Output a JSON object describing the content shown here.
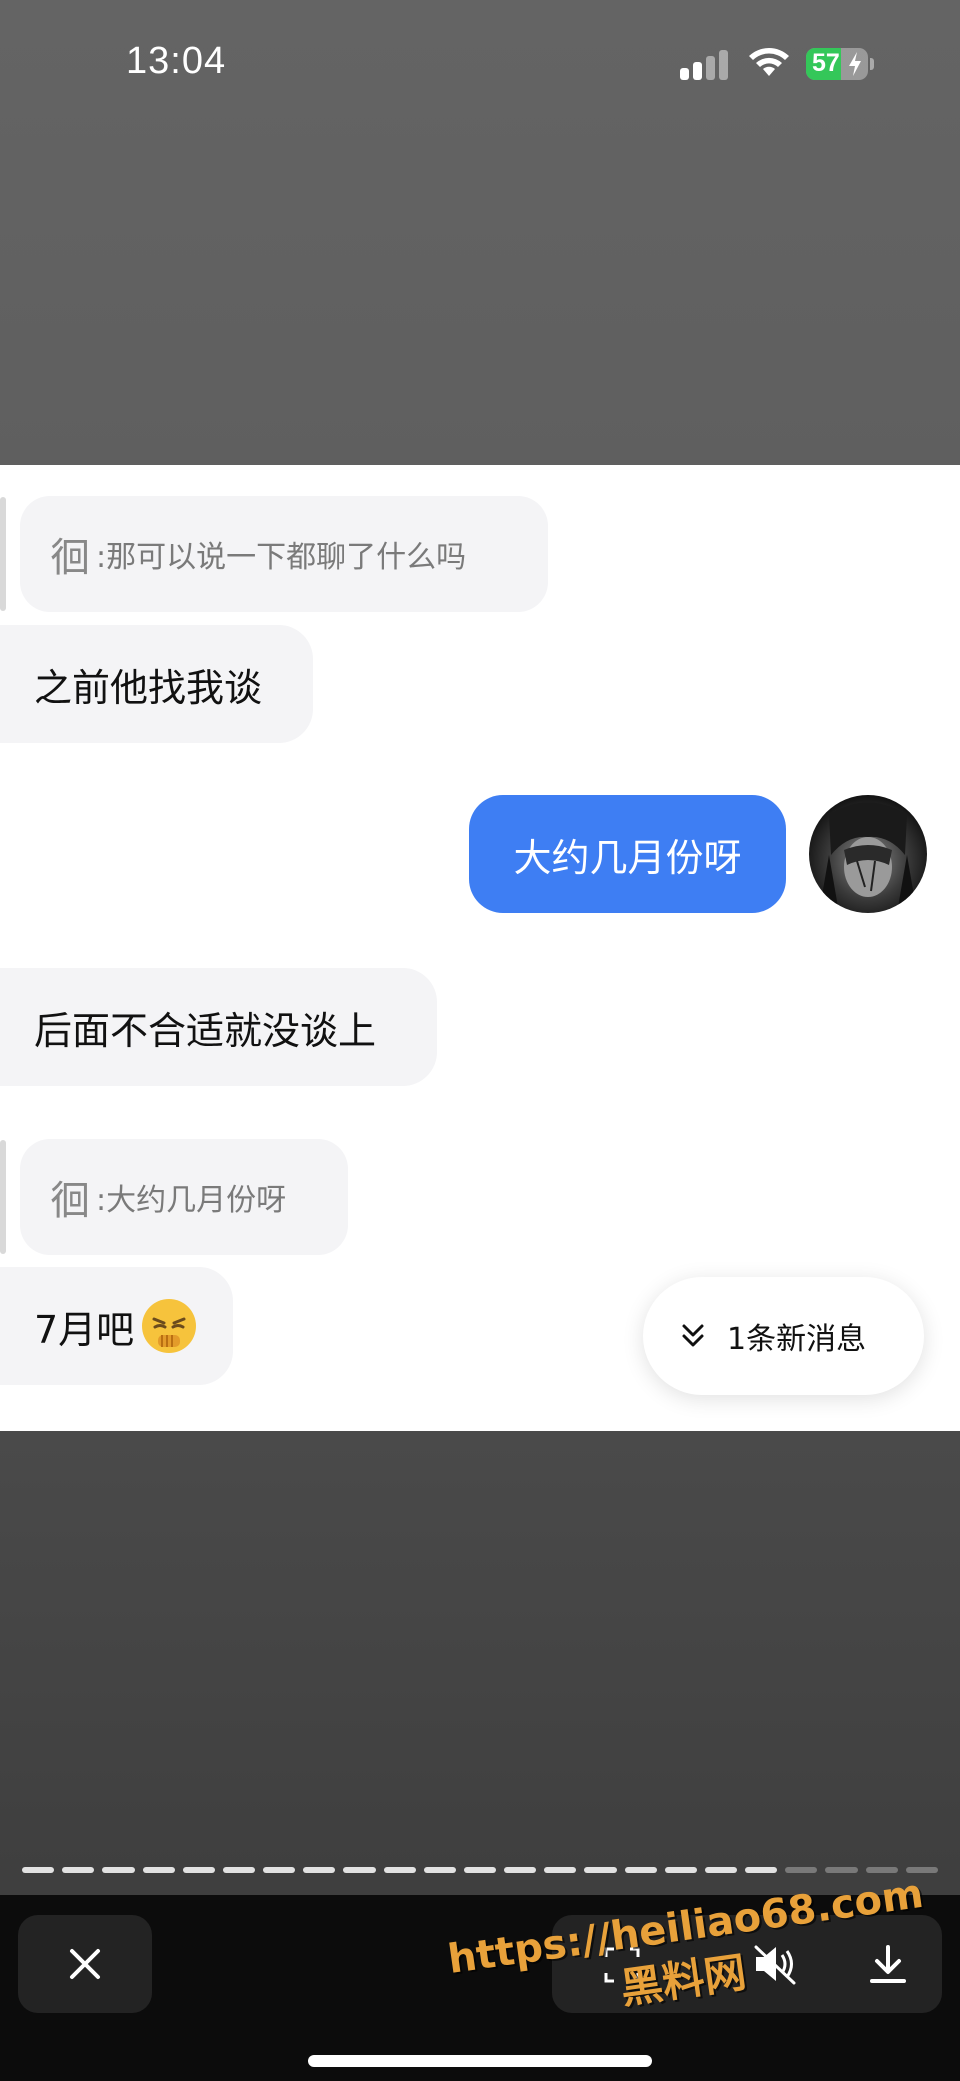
{
  "status_bar": {
    "time": "13:04",
    "battery_level": "57",
    "battery_fraction": 0.57,
    "icons": [
      "cellular-signal-icon",
      "wifi-icon",
      "battery-charging-icon"
    ]
  },
  "chat": {
    "quote1": {
      "name": "徊",
      "text": ":那可以说一下都聊了什么吗"
    },
    "msg1": "之前他找我谈",
    "msg2_outgoing": "大约几月份呀",
    "msg3": "后面不合适就没谈上",
    "quote2": {
      "name": "徊",
      "text": ":大约几月份呀"
    },
    "msg4": "7月吧",
    "msg4_emoji": "thinking-emoji",
    "new_messages": "1条新消息"
  },
  "story": {
    "segments_total": 23,
    "segments_viewed": 19
  },
  "bottom_bar": {
    "icons": [
      "close-icon",
      "scan-icon",
      "mute-icon",
      "download-icon"
    ]
  },
  "watermark": {
    "url": "https://heiliao68.com",
    "name": "黑料网"
  },
  "colors": {
    "outgoing_bubble": "#3e7ef3",
    "incoming_bubble": "#f4f4f6",
    "battery_green": "#34c759",
    "watermark": "#e8a13a"
  }
}
